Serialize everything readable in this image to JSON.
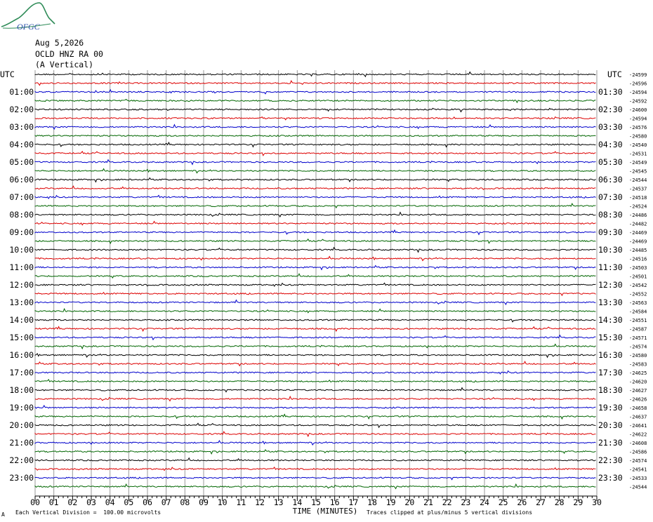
{
  "logo": {
    "text": "OFGC"
  },
  "header": {
    "date": "Aug 5,2026",
    "station": "OCLD HNZ RA 00",
    "component": "(A Vertical)"
  },
  "footer": {
    "scale_note": "Each Vertical Division =  100.00 microvolts",
    "clip_note": "Traces clipped at plus/minus 5 vertical divisions",
    "corner_mark": "A"
  },
  "colors": {
    "trace_cycle": [
      "#000000",
      "#dd0000",
      "#0000cc",
      "#006600"
    ],
    "grid": "#9a9a9a"
  },
  "chart_data": {
    "type": "line",
    "title": "",
    "xlabel": "TIME (MINUTES)",
    "xlim": [
      0,
      30
    ],
    "x_ticks": [
      "00",
      "01",
      "02",
      "03",
      "04",
      "05",
      "06",
      "07",
      "08",
      "09",
      "10",
      "11",
      "12",
      "13",
      "14",
      "15",
      "16",
      "17",
      "18",
      "19",
      "20",
      "21",
      "22",
      "23",
      "24",
      "25",
      "26",
      "27",
      "28",
      "29",
      "30"
    ],
    "left_axis_title": "UTC",
    "right_axis_title": "UTC",
    "left_labels": [
      "01:00",
      "02:00",
      "03:00",
      "04:00",
      "05:00",
      "06:00",
      "07:00",
      "08:00",
      "09:00",
      "10:00",
      "11:00",
      "12:00",
      "13:00",
      "14:00",
      "15:00",
      "16:00",
      "17:00",
      "18:00",
      "19:00",
      "20:00",
      "21:00",
      "22:00",
      "23:00"
    ],
    "right_labels": [
      "01:30",
      "02:30",
      "03:30",
      "04:30",
      "05:30",
      "06:30",
      "07:30",
      "08:30",
      "09:30",
      "10:30",
      "11:30",
      "12:30",
      "13:30",
      "14:30",
      "15:30",
      "16:30",
      "17:30",
      "18:30",
      "19:30",
      "20:30",
      "21:30",
      "22:30",
      "23:30"
    ],
    "trace_count": 48,
    "trace_offsets": [
      -24599,
      -24596,
      -24594,
      -24592,
      -24600,
      -24594,
      -24576,
      -24580,
      -24540,
      -24531,
      -24549,
      -24545,
      -24544,
      -24537,
      -24518,
      -24524,
      -24486,
      -24482,
      -24469,
      -24469,
      -24485,
      -24516,
      -24503,
      -24501,
      -24542,
      -24552,
      -24563,
      -24584,
      -24551,
      -24587,
      -24571,
      -24574,
      -24580,
      -24583,
      -24625,
      -24620,
      -24627,
      -24626,
      -24658,
      -24637,
      -24641,
      -24622,
      -24608,
      -24586,
      -24574,
      -24541,
      -24533,
      -24544
    ]
  }
}
